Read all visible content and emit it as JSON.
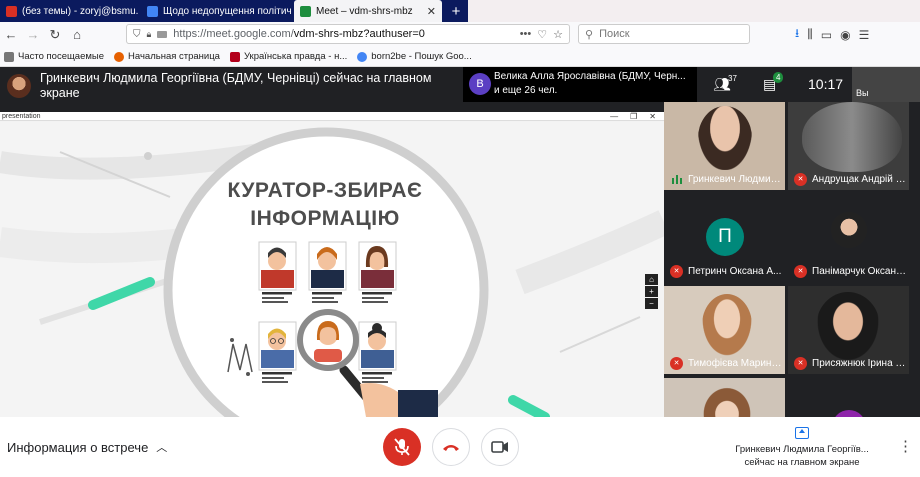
{
  "browser": {
    "tabs": [
      {
        "label": "(без темы) - zoryj@bsmu.edu.ua",
        "favicon_color": "#d93025",
        "active": false
      },
      {
        "label": "Щодо недопущення політичн",
        "favicon_color": "#4285f4",
        "active": false
      },
      {
        "label": "Meet – vdm-shrs-mbz",
        "favicon_color": "#1e8e3e",
        "active": true
      }
    ],
    "url_prefix": "https://meet.google.com/",
    "url_path": "vdm-shrs-mbz?authuser=0",
    "search_placeholder": "Поиск",
    "bookmarks": [
      {
        "label": "Часто посещаемые",
        "color": "#777777"
      },
      {
        "label": "Начальная страница",
        "color": "#e66000"
      },
      {
        "label": "Українська правда - н...",
        "color": "#b3001b"
      },
      {
        "label": "born2be - Пошук Goo...",
        "color": "#4285f4"
      }
    ]
  },
  "meet": {
    "presenter_title": "Гринкевич Людмила Георгіївна (БДМУ, Чернівці) сейчас на главном экране",
    "join_notice_name": "Велика Алла Ярославівна (БДМУ, Черн...",
    "join_notice_more": "и еще 26 чел.",
    "join_avatar_letter": "В",
    "people_count": "37",
    "chat_count": "4",
    "time": "10:17",
    "self_label": "Вы",
    "presentation_window_title": "presentation",
    "slide_title_line1": "КУРАТОР-ЗБИРАЄ",
    "slide_title_line2": "ІНФОРМАЦІЮ",
    "zoom_controls": [
      "⌂",
      "+",
      "−"
    ],
    "participants": [
      {
        "name": "Гринкевич Людмил...",
        "muted": false
      },
      {
        "name": "Андрущак Андрій В...",
        "muted": true
      },
      {
        "name": "Петринч Оксана А...",
        "muted": true,
        "letter": "П"
      },
      {
        "name": "Панімарчук Оксана ...",
        "muted": true
      },
      {
        "name": "Тимофієва Марина ...",
        "muted": true
      },
      {
        "name": "Присяжнюк Ірина В...",
        "muted": true
      }
    ],
    "meeting_info_label": "Информация о встрече",
    "present_label_line1": "Гринкевич Людмила Георгіїв...",
    "present_label_line2": "сейчас на главном экране"
  },
  "colors": {
    "meet_bg": "#202124",
    "mic_red": "#d93025",
    "accent_blue": "#1a73e8",
    "tab_strip": "#0b1a5e"
  }
}
